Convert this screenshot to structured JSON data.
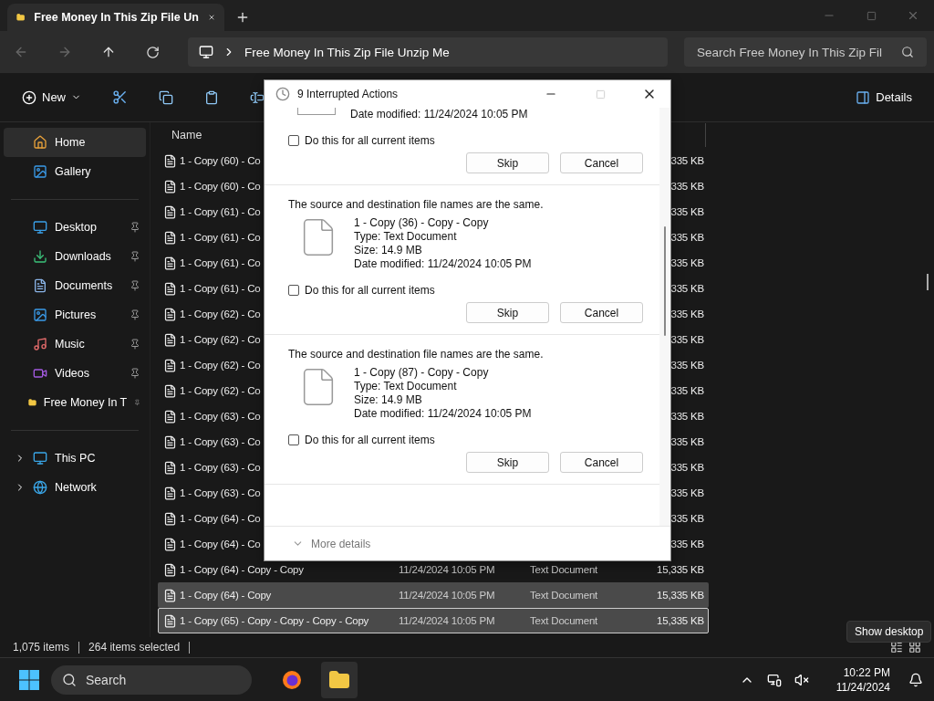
{
  "tab": {
    "title": "Free Money In This Zip File Un"
  },
  "address": {
    "path": "Free Money In This Zip File Unzip Me"
  },
  "search": {
    "placeholder": "Search Free Money In This Zip Fil"
  },
  "toolbar": {
    "new_label": "New",
    "details_label": "Details"
  },
  "sidebar": {
    "groups": [
      [
        {
          "label": "Home",
          "selected": true,
          "pinned": false
        },
        {
          "label": "Gallery",
          "selected": false,
          "pinned": false
        }
      ],
      [
        {
          "label": "Desktop",
          "selected": false,
          "pinned": true
        },
        {
          "label": "Downloads",
          "selected": false,
          "pinned": true
        },
        {
          "label": "Documents",
          "selected": false,
          "pinned": true
        },
        {
          "label": "Pictures",
          "selected": false,
          "pinned": true
        },
        {
          "label": "Music",
          "selected": false,
          "pinned": true
        },
        {
          "label": "Videos",
          "selected": false,
          "pinned": true
        },
        {
          "label": "Free Money In T",
          "selected": false,
          "pinned": true
        }
      ],
      [
        {
          "label": "This PC",
          "selected": false,
          "pinned": false,
          "expanded": false
        },
        {
          "label": "Network",
          "selected": false,
          "pinned": false,
          "expanded": false
        }
      ]
    ]
  },
  "table": {
    "columns": [
      "Name"
    ],
    "rows": [
      {
        "name": "1 - Copy (60) - Co",
        "size": "335 KB",
        "selected": false,
        "focused": false
      },
      {
        "name": "1 - Copy (60) - Co",
        "size": "335 KB",
        "selected": false,
        "focused": false
      },
      {
        "name": "1 - Copy (61) - Co",
        "size": "335 KB",
        "selected": false,
        "focused": false
      },
      {
        "name": "1 - Copy (61) - Co",
        "size": "335 KB",
        "selected": false,
        "focused": false
      },
      {
        "name": "1 - Copy (61) - Co",
        "size": "335 KB",
        "selected": false,
        "focused": false
      },
      {
        "name": "1 - Copy (61) - Co",
        "size": "335 KB",
        "selected": false,
        "focused": false
      },
      {
        "name": "1 - Copy (62) - Co",
        "size": "335 KB",
        "selected": false,
        "focused": false
      },
      {
        "name": "1 - Copy (62) - Co",
        "size": "335 KB",
        "selected": false,
        "focused": false
      },
      {
        "name": "1 - Copy (62) - Co",
        "size": "335 KB",
        "selected": false,
        "focused": false
      },
      {
        "name": "1 - Copy (62) - Co",
        "size": "335 KB",
        "selected": false,
        "focused": false
      },
      {
        "name": "1 - Copy (63) - Co",
        "size": "335 KB",
        "selected": false,
        "focused": false
      },
      {
        "name": "1 - Copy (63) - Co",
        "size": "335 KB",
        "selected": false,
        "focused": false
      },
      {
        "name": "1 - Copy (63) - Co",
        "size": "335 KB",
        "selected": false,
        "focused": false
      },
      {
        "name": "1 - Copy (63) - Co",
        "size": "335 KB",
        "selected": false,
        "focused": false
      },
      {
        "name": "1 - Copy (64) - Co",
        "size": "335 KB",
        "selected": false,
        "focused": false
      },
      {
        "name": "1 - Copy (64) - Co",
        "size": "335 KB",
        "selected": false,
        "focused": false
      },
      {
        "name": "1 - Copy (64) - Copy - Copy",
        "date": "11/24/2024 10:05 PM",
        "type": "Text Document",
        "size": "15,335 KB",
        "selected": false,
        "focused": false
      },
      {
        "name": "1 - Copy (64) - Copy",
        "date": "11/24/2024 10:05 PM",
        "type": "Text Document",
        "size": "15,335 KB",
        "selected": true,
        "focused": false
      },
      {
        "name": "1 - Copy (65) - Copy - Copy - Copy - Copy",
        "date": "11/24/2024 10:05 PM",
        "type": "Text Document",
        "size": "15,335 KB",
        "selected": true,
        "focused": true
      }
    ]
  },
  "status_bar": {
    "item_count": "1,075 items",
    "selection": "264 items selected"
  },
  "dialog": {
    "title": "9 Interrupted Actions",
    "conflicts": [
      {
        "date_modified": "Date modified: 11/24/2024 10:05 PM",
        "apply_all": "Do this for all current items",
        "checked": false,
        "skip": "Skip",
        "cancel": "Cancel"
      },
      {
        "message": "The source and destination file names are the same.",
        "file_name": "1 - Copy (36) - Copy - Copy",
        "file_type": "Type: Text Document",
        "file_size": "Size: 14.9 MB",
        "date_modified": "Date modified: 11/24/2024 10:05 PM",
        "apply_all": "Do this for all current items",
        "checked": false,
        "skip": "Skip",
        "cancel": "Cancel"
      },
      {
        "message": "The source and destination file names are the same.",
        "file_name": "1 - Copy (87) - Copy - Copy",
        "file_type": "Type: Text Document",
        "file_size": "Size: 14.9 MB",
        "date_modified": "Date modified: 11/24/2024 10:05 PM",
        "apply_all": "Do this for all current items",
        "checked": false,
        "skip": "Skip",
        "cancel": "Cancel"
      }
    ],
    "more_details": "More details"
  },
  "tooltip": "Show desktop",
  "taskbar": {
    "search_placeholder": "Search",
    "time": "10:22 PM",
    "date": "11/24/2024"
  }
}
